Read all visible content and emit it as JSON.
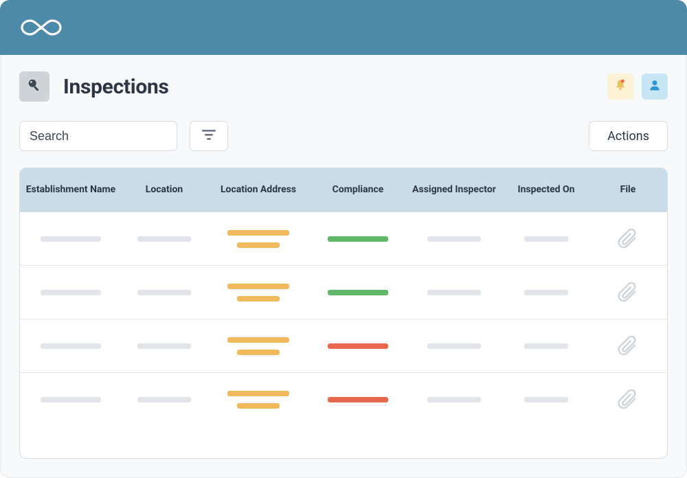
{
  "page": {
    "title": "Inspections"
  },
  "search": {
    "placeholder": "Search",
    "value": ""
  },
  "actions": {
    "label": "Actions"
  },
  "table": {
    "columns": [
      "Establishment Name",
      "Location",
      "Location Address",
      "Compliance",
      "Assigned Inspector",
      "Inspected On",
      "File"
    ],
    "rows": [
      {
        "compliance": "green"
      },
      {
        "compliance": "green"
      },
      {
        "compliance": "red"
      },
      {
        "compliance": "red"
      }
    ]
  },
  "colors": {
    "topbar": "#4c8aa8",
    "header_bg": "#c8dce9",
    "grey_bar": "#e1e4e8",
    "orange_bar": "#f3b95c",
    "green_bar": "#60b769",
    "red_bar": "#e9694f"
  }
}
